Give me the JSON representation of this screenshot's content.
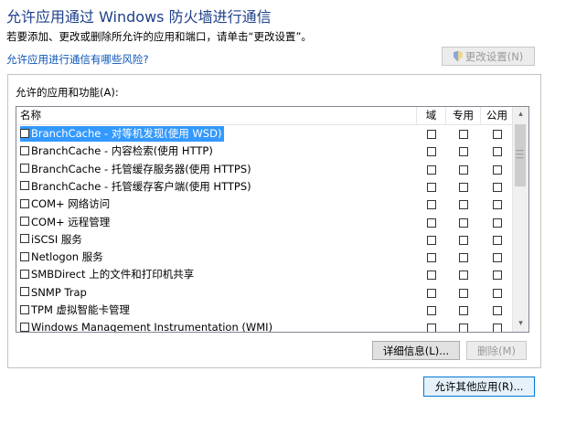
{
  "header": {
    "title": "允许应用通过 Windows 防火墙进行通信",
    "subtitle": "若要添加、更改或删除所允许的应用和端口，请单击“更改设置”。",
    "risk_link": "允许应用进行通信有哪些风险?",
    "change_settings": "更改设置(N)"
  },
  "apps": {
    "group_label": "允许的应用和功能(A):",
    "columns": {
      "name": "名称",
      "domain": "域",
      "private": "专用",
      "public": "公用"
    },
    "rows": [
      {
        "name": "BranchCache - 对等机发现(使用 WSD)"
      },
      {
        "name": "BranchCache - 内容检索(使用 HTTP)"
      },
      {
        "name": "BranchCache - 托管缓存服务器(使用 HTTPS)"
      },
      {
        "name": "BranchCache - 托管缓存客户端(使用 HTTPS)"
      },
      {
        "name": "COM+ 网络访问"
      },
      {
        "name": "COM+ 远程管理"
      },
      {
        "name": "iSCSI 服务"
      },
      {
        "name": "Netlogon 服务"
      },
      {
        "name": "SMBDirect 上的文件和打印机共享"
      },
      {
        "name": "SNMP Trap"
      },
      {
        "name": "TPM 虚拟智能卡管理"
      },
      {
        "name": "Windows Management Instrumentation (WMI)"
      }
    ],
    "selected_index": 0,
    "details_button": "详细信息(L)...",
    "remove_button": "删除(M)"
  },
  "footer": {
    "allow_other_button": "允许其他应用(R)..."
  },
  "icons": {
    "shield": "uac-shield-icon",
    "scroll_up": "chevron-up-icon",
    "scroll_down": "chevron-down-icon"
  }
}
